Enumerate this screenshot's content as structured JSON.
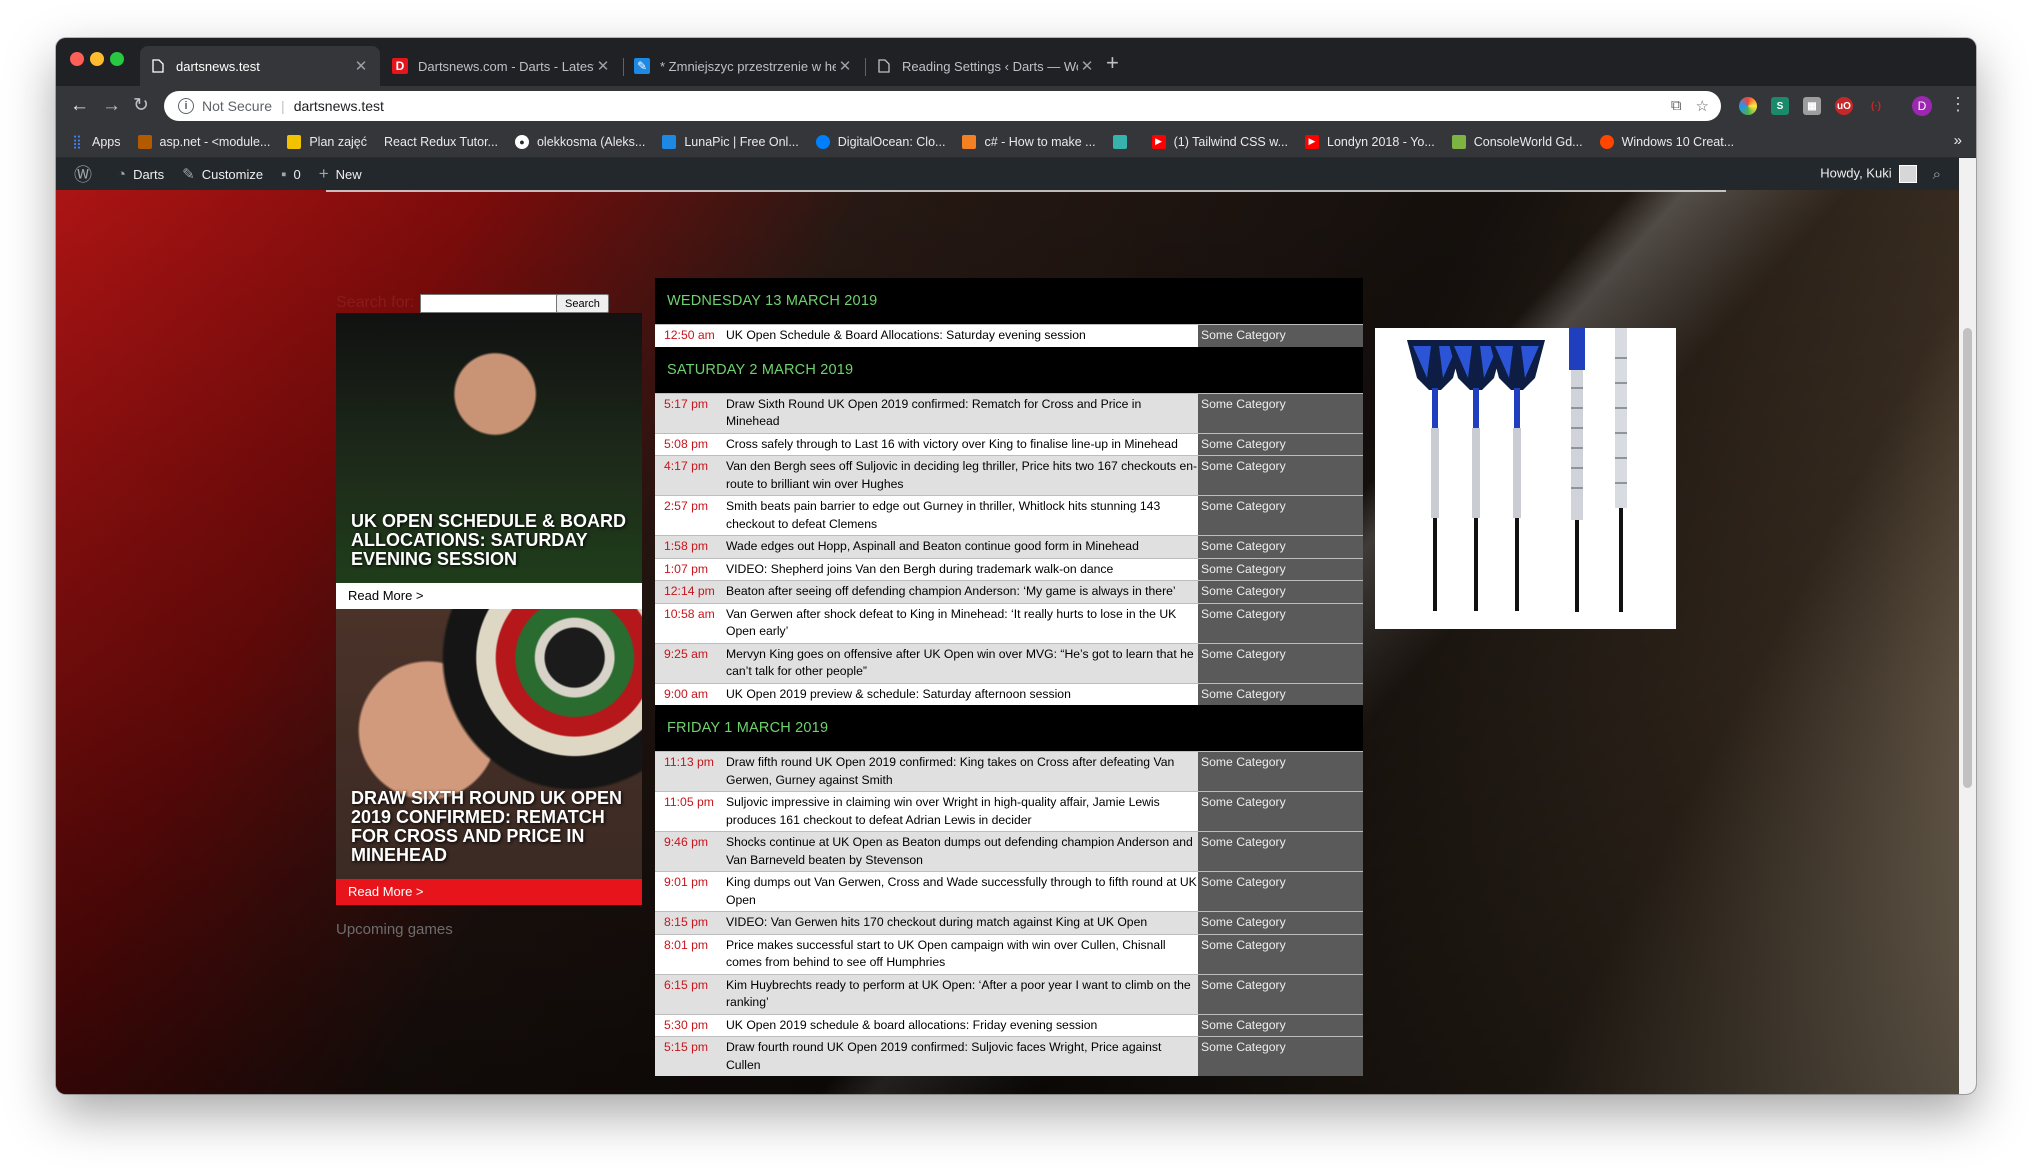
{
  "browser": {
    "tabs": [
      {
        "label": "dartsnews.test",
        "active": true,
        "icon": "page-icon"
      },
      {
        "label": "Dartsnews.com - Darts - Latest",
        "active": false,
        "icon": "dartsnews-favicon"
      },
      {
        "label": "* Zmniejszyc przestrzenie w he",
        "active": false,
        "icon": "stackoverflow-favicon"
      },
      {
        "label": "Reading Settings ‹ Darts — Wo",
        "active": false,
        "icon": "page-icon"
      }
    ],
    "address": {
      "security": "Not Secure",
      "url": "dartsnews.test"
    },
    "profile_initial": "D",
    "bookmarks": [
      {
        "label": "Apps",
        "icon": "apps-grid-icon",
        "color": "#4285f4"
      },
      {
        "label": "asp.net - <module...",
        "icon": "aspnet-favicon",
        "color": "#b35900"
      },
      {
        "label": "Plan zajęć",
        "icon": "plan-favicon",
        "color": "#f2c200"
      },
      {
        "label": "React Redux Tutor...",
        "icon": "none",
        "color": "#35363a"
      },
      {
        "label": "olekkosma (Aleks...",
        "icon": "github-icon",
        "color": "#24292e"
      },
      {
        "label": "LunaPic | Free Onl...",
        "icon": "lunapic-favicon",
        "color": "#1e88e5"
      },
      {
        "label": "DigitalOcean: Clo...",
        "icon": "digitalocean-favicon",
        "color": "#0080ff"
      },
      {
        "label": "c# - How to make ...",
        "icon": "stackoverflow-favicon",
        "color": "#f48024"
      },
      {
        "label": "",
        "icon": "tailwind-favicon",
        "color": "#38b2ac"
      },
      {
        "label": "(1) Tailwind CSS w...",
        "icon": "youtube-favicon",
        "color": "#ff0000"
      },
      {
        "label": "Londyn 2018 - Yo...",
        "icon": "youtube-favicon",
        "color": "#ff0000"
      },
      {
        "label": "ConsoleWorld Gd...",
        "icon": "consoleworld-favicon",
        "color": "#7cb342"
      },
      {
        "label": "Windows 10 Creat...",
        "icon": "reddit-favicon",
        "color": "#ff4500"
      }
    ]
  },
  "adminbar": {
    "site": "Darts",
    "customize": "Customize",
    "comments": "0",
    "new": "New",
    "howdy": "Howdy, Kuki"
  },
  "search": {
    "label": "Search for:",
    "button": "Search"
  },
  "cards": [
    {
      "title": "UK OPEN SCHEDULE & BOARD ALLOCATIONS: SATURDAY EVENING SESSION",
      "read_more": "Read More >"
    },
    {
      "title": "DRAW SIXTH ROUND UK OPEN 2019 CONFIRMED: REMATCH FOR CROSS AND PRICE IN MINEHEAD",
      "read_more": "Read More >"
    }
  ],
  "upcoming": "Upcoming games",
  "schedule": [
    {
      "day": "WEDNESDAY 13 MARCH 2019",
      "items": [
        {
          "time": "12:50 am",
          "title": "UK Open Schedule & Board Allocations: Saturday evening session",
          "category": "Some Category"
        }
      ]
    },
    {
      "day": "SATURDAY 2 MARCH 2019",
      "items": [
        {
          "time": "5:17 pm",
          "title": "Draw Sixth Round UK Open 2019 confirmed: Rematch for Cross and Price in Minehead",
          "category": "Some Category"
        },
        {
          "time": "5:08 pm",
          "title": "Cross safely through to Last 16 with victory over King to finalise line-up in Minehead",
          "category": "Some Category"
        },
        {
          "time": "4:17 pm",
          "title": "Van den Bergh sees off Suljovic in deciding leg thriller, Price hits two 167 checkouts en-route to brilliant win over Hughes",
          "category": "Some Category"
        },
        {
          "time": "2:57 pm",
          "title": "Smith beats pain barrier to edge out Gurney in thriller, Whitlock hits stunning 143 checkout to defeat Clemens",
          "category": "Some Category"
        },
        {
          "time": "1:58 pm",
          "title": "Wade edges out Hopp, Aspinall and Beaton continue good form in Minehead",
          "category": "Some Category"
        },
        {
          "time": "1:07 pm",
          "title": "VIDEO: Shepherd joins Van den Bergh during trademark walk-on dance",
          "category": "Some Category"
        },
        {
          "time": "12:14 pm",
          "title": "Beaton after seeing off defending champion Anderson: ‘My game is always in there’",
          "category": "Some Category"
        },
        {
          "time": "10:58 am",
          "title": "Van Gerwen after shock defeat to King in Minehead: ‘It really hurts to lose in the UK Open early’",
          "category": "Some Category"
        },
        {
          "time": "9:25 am",
          "title": "Mervyn King goes on offensive after UK Open win over MVG: “He’s got to learn that he can’t talk for other people”",
          "category": "Some Category"
        },
        {
          "time": "9:00 am",
          "title": "UK Open 2019 preview & schedule: Saturday afternoon session",
          "category": "Some Category"
        }
      ]
    },
    {
      "day": "FRIDAY 1 MARCH 2019",
      "items": [
        {
          "time": "11:13 pm",
          "title": "Draw fifth round UK Open 2019 confirmed: King takes on Cross after defeating Van Gerwen, Gurney against Smith",
          "category": "Some Category"
        },
        {
          "time": "11:05 pm",
          "title": "Suljovic impressive in claiming win over Wright in high-quality affair, Jamie Lewis produces 161 checkout to defeat Adrian Lewis in decider",
          "category": "Some Category"
        },
        {
          "time": "9:46 pm",
          "title": "Shocks continue at UK Open as Beaton dumps out defending champion Anderson and Van Barneveld beaten by Stevenson",
          "category": "Some Category"
        },
        {
          "time": "9:01 pm",
          "title": "King dumps out Van Gerwen, Cross and Wade successfully through to fifth round at UK Open",
          "category": "Some Category"
        },
        {
          "time": "8:15 pm",
          "title": "VIDEO: Van Gerwen hits 170 checkout during match against King at UK Open",
          "category": "Some Category"
        },
        {
          "time": "8:01 pm",
          "title": "Price makes successful start to UK Open campaign with win over Cullen, Chisnall comes from behind to see off Humphries",
          "category": "Some Category"
        },
        {
          "time": "6:15 pm",
          "title": "Kim Huybrechts ready to perform at UK Open: ‘After a poor year I want to climb on the ranking’",
          "category": "Some Category"
        },
        {
          "time": "5:30 pm",
          "title": "UK Open 2019 schedule & board allocations: Friday evening session",
          "category": "Some Category"
        },
        {
          "time": "5:15 pm",
          "title": "Draw fourth round UK Open 2019 confirmed: Suljovic faces Wright, Price against Cullen",
          "category": "Some Category"
        }
      ]
    }
  ]
}
